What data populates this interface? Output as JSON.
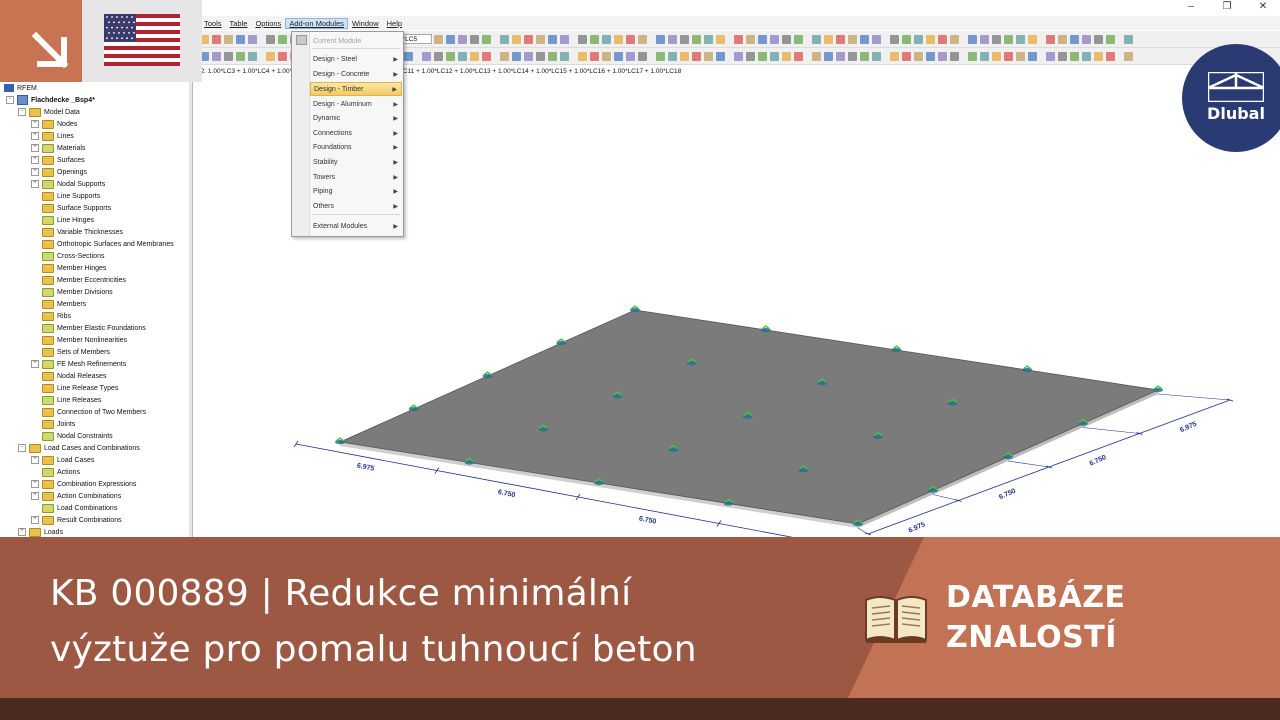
{
  "window": {
    "controls": [
      "–",
      "❐",
      "✕"
    ]
  },
  "menubar": {
    "items": [
      {
        "label": "Tools"
      },
      {
        "label": "Table"
      },
      {
        "label": "Options"
      },
      {
        "label": "Add-on Modules"
      },
      {
        "label": "Window"
      },
      {
        "label": "Help"
      }
    ],
    "active": "Add-on Modules"
  },
  "toolbar": {
    "lc_selector": "0*LC5"
  },
  "load_combination_text": "C2: 1.00*LC3 + 1.00*LC4 + 1.00*LC8 + 1.00*LC9 + 1.00*LC10 + 1.00*LC11 + 1.00*LC12 + 1.00*LC13 + 1.00*LC14 + 1.00*LC15 + 1.00*LC16 + 1.00*LC17 + 1.00*LC18",
  "navigator": {
    "root": "RFEM",
    "project": "Flachdecke _Bsp4*",
    "items": [
      {
        "label": "Model Data",
        "level": 1,
        "expand": "-"
      },
      {
        "label": "Nodes",
        "level": 2,
        "expand": "+"
      },
      {
        "label": "Lines",
        "level": 2,
        "expand": "+"
      },
      {
        "label": "Materials",
        "level": 2,
        "expand": "+"
      },
      {
        "label": "Surfaces",
        "level": 2,
        "expand": "+"
      },
      {
        "label": "Openings",
        "level": 2,
        "expand": "+"
      },
      {
        "label": "Nodal Supports",
        "level": 2,
        "expand": "+"
      },
      {
        "label": "Line Supports",
        "level": 2,
        "expand": ""
      },
      {
        "label": "Surface Supports",
        "level": 2,
        "expand": ""
      },
      {
        "label": "Line Hinges",
        "level": 2,
        "expand": ""
      },
      {
        "label": "Variable Thicknesses",
        "level": 2,
        "expand": ""
      },
      {
        "label": "Orthotropic Surfaces and Membranes",
        "level": 2,
        "expand": ""
      },
      {
        "label": "Cross-Sections",
        "level": 2,
        "expand": ""
      },
      {
        "label": "Member Hinges",
        "level": 2,
        "expand": ""
      },
      {
        "label": "Member Eccentricities",
        "level": 2,
        "expand": ""
      },
      {
        "label": "Member Divisions",
        "level": 2,
        "expand": ""
      },
      {
        "label": "Members",
        "level": 2,
        "expand": ""
      },
      {
        "label": "Ribs",
        "level": 2,
        "expand": ""
      },
      {
        "label": "Member Elastic Foundations",
        "level": 2,
        "expand": ""
      },
      {
        "label": "Member Nonlinearities",
        "level": 2,
        "expand": ""
      },
      {
        "label": "Sets of Members",
        "level": 2,
        "expand": ""
      },
      {
        "label": "FE Mesh Refinements",
        "level": 2,
        "expand": "+"
      },
      {
        "label": "Nodal Releases",
        "level": 2,
        "expand": ""
      },
      {
        "label": "Line Release Types",
        "level": 2,
        "expand": ""
      },
      {
        "label": "Line Releases",
        "level": 2,
        "expand": ""
      },
      {
        "label": "Connection of Two Members",
        "level": 2,
        "expand": ""
      },
      {
        "label": "Joints",
        "level": 2,
        "expand": ""
      },
      {
        "label": "Nodal Constraints",
        "level": 2,
        "expand": ""
      },
      {
        "label": "Load Cases and Combinations",
        "level": 1,
        "expand": "-"
      },
      {
        "label": "Load Cases",
        "level": 2,
        "expand": "+"
      },
      {
        "label": "Actions",
        "level": 2,
        "expand": ""
      },
      {
        "label": "Combination Expressions",
        "level": 2,
        "expand": "+"
      },
      {
        "label": "Action Combinations",
        "level": 2,
        "expand": "+"
      },
      {
        "label": "Load Combinations",
        "level": 2,
        "expand": ""
      },
      {
        "label": "Result Combinations",
        "level": 2,
        "expand": "+"
      },
      {
        "label": "Loads",
        "level": 1,
        "expand": "+"
      }
    ]
  },
  "addon_menu": {
    "items": [
      {
        "label": "Current Module",
        "disabled": true,
        "submenu": false
      },
      {
        "label": "Design - Steel",
        "submenu": true
      },
      {
        "label": "Design - Concrete",
        "submenu": true
      },
      {
        "label": "Design - Timber",
        "submenu": true,
        "highlighted": true
      },
      {
        "label": "Design - Aluminum",
        "submenu": true
      },
      {
        "label": "Dynamic",
        "submenu": true
      },
      {
        "label": "Connections",
        "submenu": true
      },
      {
        "label": "Foundations",
        "submenu": true
      },
      {
        "label": "Stability",
        "submenu": true
      },
      {
        "label": "Towers",
        "submenu": true
      },
      {
        "label": "Piping",
        "submenu": true
      },
      {
        "label": "Others",
        "submenu": true
      },
      {
        "label": "External Modules",
        "submenu": true
      }
    ]
  },
  "model_view": {
    "dimensions_front": [
      "6.975",
      "6.750",
      "6.750",
      "6.975"
    ],
    "dimensions_right": [
      "6.975",
      "6.750",
      "6.750",
      "6.975"
    ],
    "slab_color": "#7b7b7b",
    "support_color": "#3ccc3c"
  },
  "banner": {
    "title_line1": "KB 000889 | Redukce minimální",
    "title_line2": "výztuže pro pomalu tuhnoucí beton",
    "category_line1": "DATABÁZE",
    "category_line2": "ZNALOSTÍ"
  },
  "logo": {
    "text": "Dlubal"
  },
  "colors": {
    "banner_dark": "#9c5842",
    "banner_light": "#c27355",
    "bottom_bar": "#4a2b1f",
    "logo_blue": "#2a3a73",
    "corner": "#c87352"
  }
}
